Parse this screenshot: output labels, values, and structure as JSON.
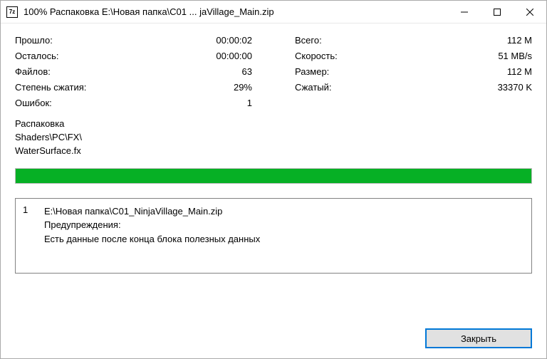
{
  "titlebar": {
    "icon_text": "7z",
    "title": "100% Распаковка E:\\Новая папка\\C01 ... jaVillage_Main.zip"
  },
  "stats": {
    "left": {
      "elapsed_label": "Прошло:",
      "elapsed_value": "00:00:02",
      "remaining_label": "Осталось:",
      "remaining_value": "00:00:00",
      "files_label": "Файлов:",
      "files_value": "63",
      "ratio_label": "Степень сжатия:",
      "ratio_value": "29%",
      "errors_label": "Ошибок:",
      "errors_value": "1"
    },
    "right": {
      "total_label": "Всего:",
      "total_value": "112 M",
      "speed_label": "Скорость:",
      "speed_value": "51 MB/s",
      "size_label": "Размер:",
      "size_value": "112 M",
      "compressed_label": "Сжатый:",
      "compressed_value": "33370 K"
    }
  },
  "status": {
    "operation": "Распаковка",
    "path_line1": "Shaders\\PC\\FX\\",
    "path_line2": "WaterSurface.fx"
  },
  "progress": {
    "percent": 100
  },
  "messages": {
    "num": "1",
    "file": "E:\\Новая папка\\C01_NinjaVillage_Main.zip",
    "warnings_label": "Предупреждения:",
    "warning_text": "Есть данные после конца блока полезных данных"
  },
  "buttons": {
    "close": "Закрыть"
  }
}
